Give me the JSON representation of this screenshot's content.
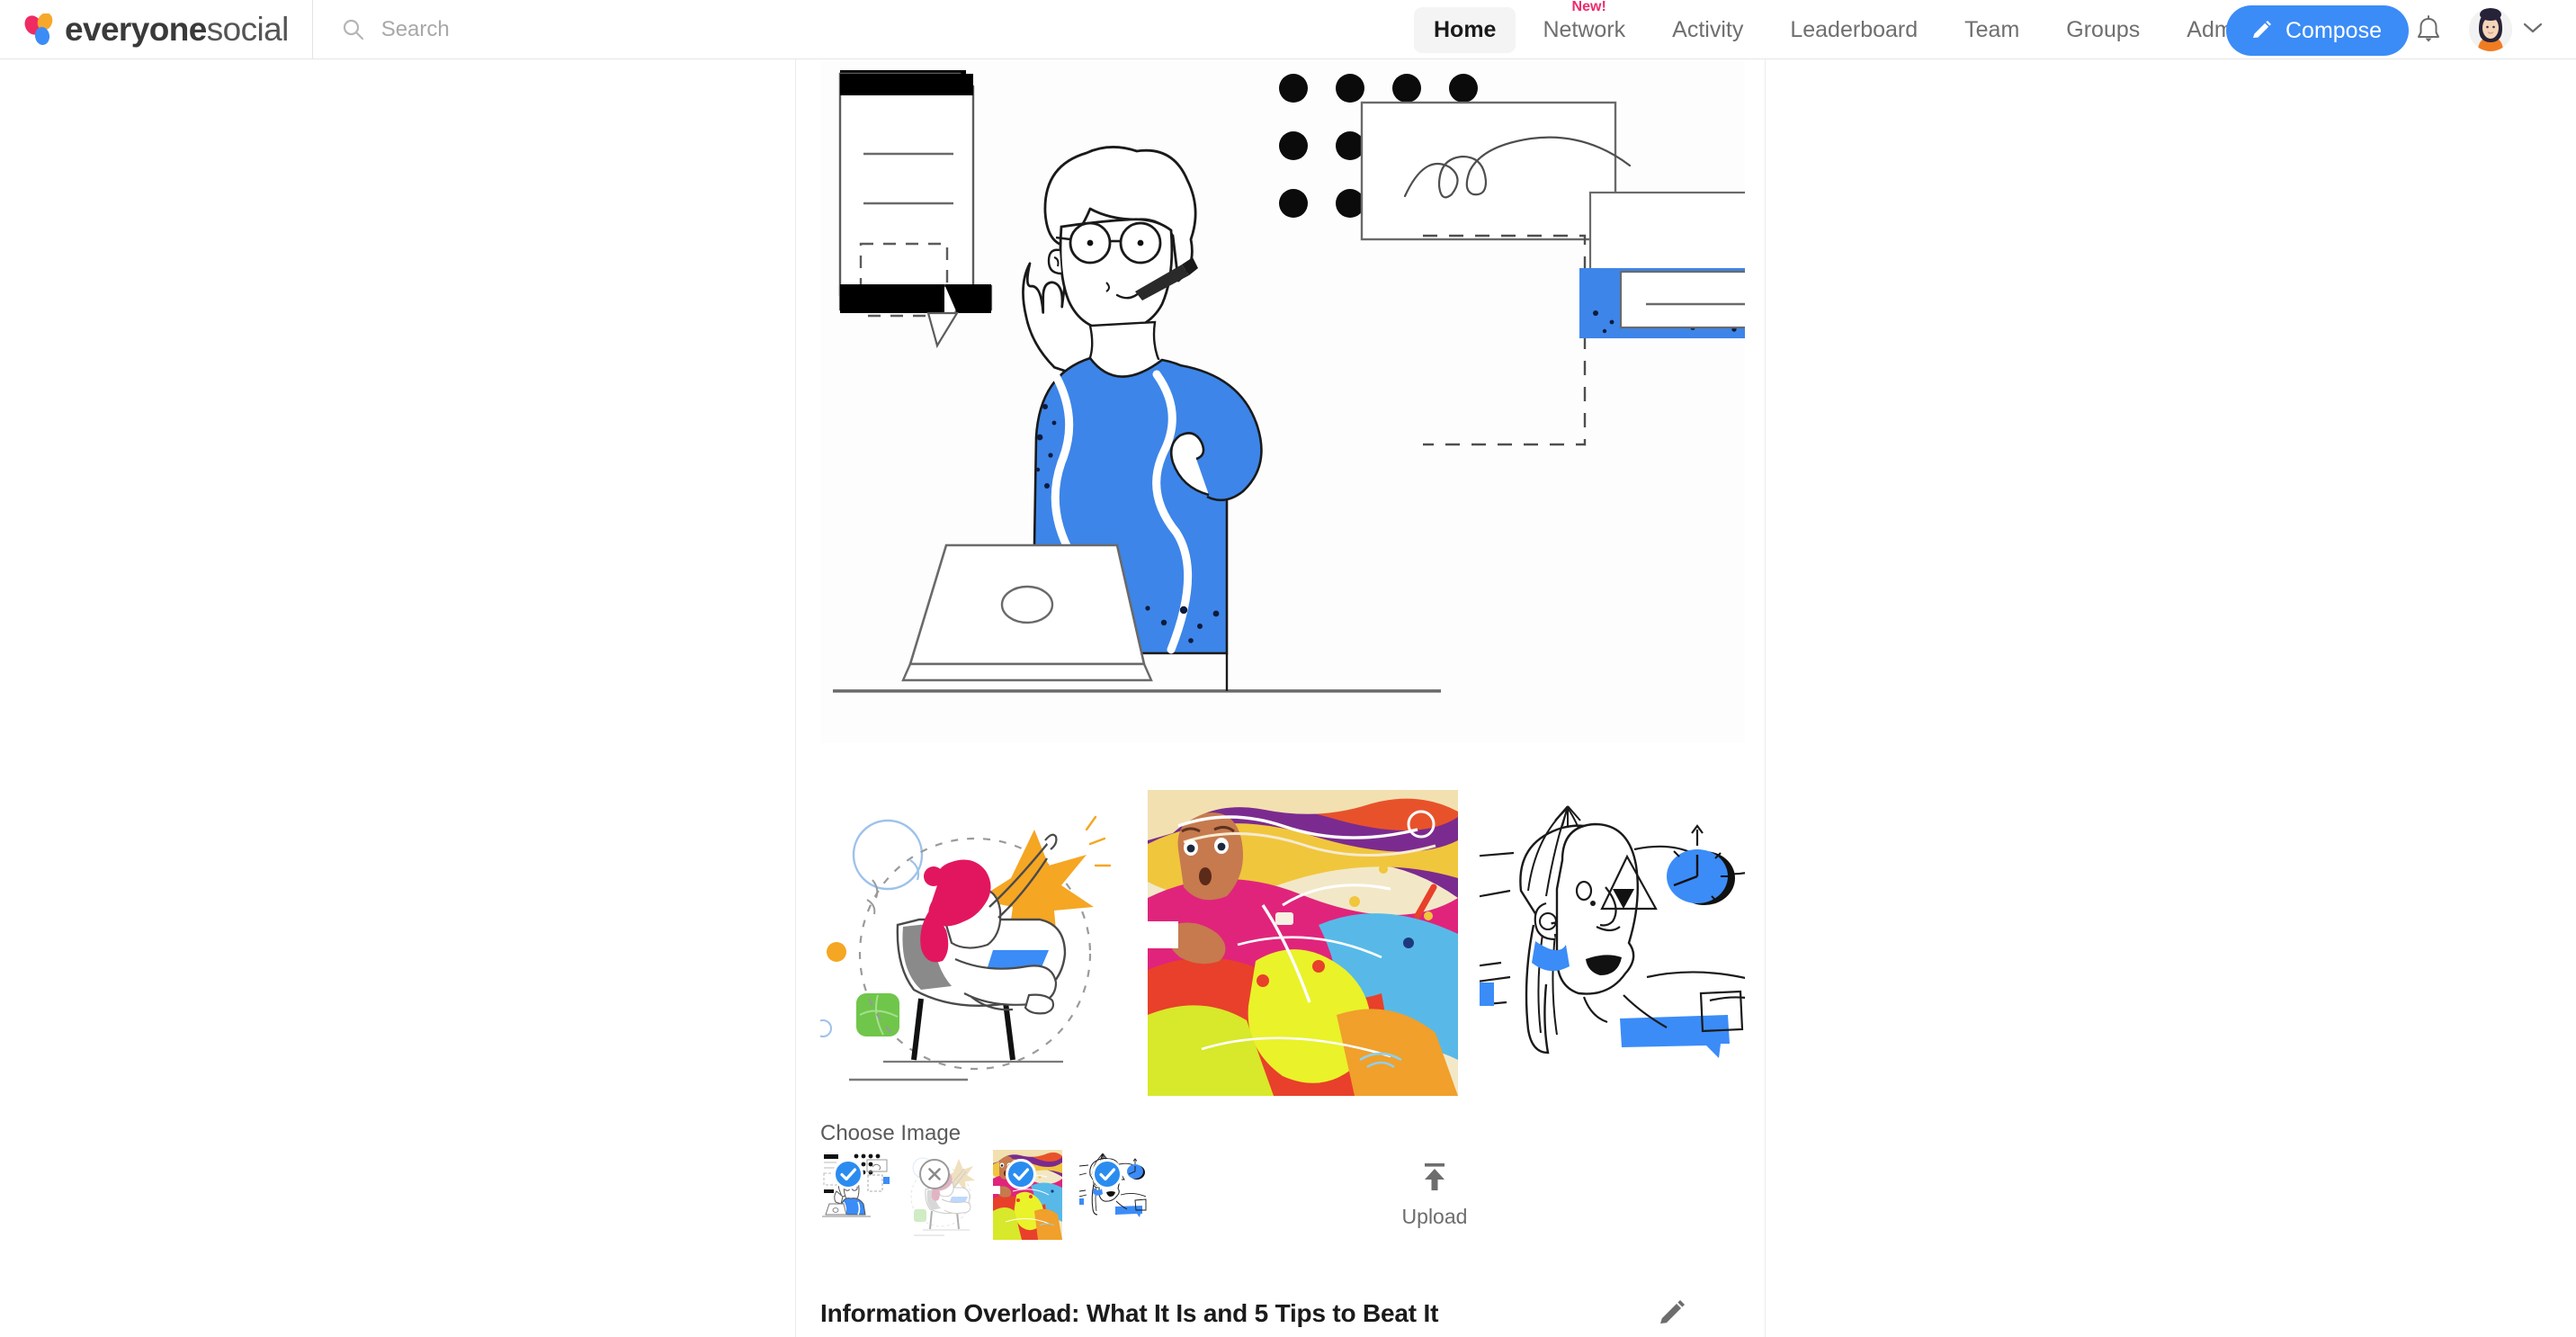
{
  "header": {
    "brand": {
      "name_bold": "everyone",
      "name_light": "social",
      "icon": "everyonesocial-logo-icon"
    },
    "search": {
      "placeholder": "Search",
      "value": "",
      "icon": "search-icon"
    },
    "nav": [
      {
        "label": "Home",
        "active": true,
        "badge": ""
      },
      {
        "label": "Network",
        "active": false,
        "badge": "New!"
      },
      {
        "label": "Activity",
        "active": false,
        "badge": ""
      },
      {
        "label": "Leaderboard",
        "active": false,
        "badge": ""
      },
      {
        "label": "Team",
        "active": false,
        "badge": ""
      },
      {
        "label": "Groups",
        "active": false,
        "badge": ""
      },
      {
        "label": "Admin",
        "active": false,
        "badge": ""
      }
    ],
    "compose": {
      "label": "Compose",
      "icon": "pencil-icon",
      "color": "#3b8cf7"
    },
    "notifications": {
      "icon": "bell-icon"
    },
    "account": {
      "icon": "avatar-icon",
      "chevron": "chevron-down-icon"
    }
  },
  "composer": {
    "hero_image": {
      "alt": "line-art woman with glasses at laptop",
      "accent": "#3d85e8"
    },
    "gallery": [
      {
        "alt": "woman reading in chair with star",
        "selected": false
      },
      {
        "alt": "colorful psychedelic portrait",
        "selected": true
      },
      {
        "alt": "line-art face with blue clock",
        "selected": true
      }
    ],
    "choose_image_label": "Choose Image",
    "thumbnails": [
      {
        "alt": "woman with glasses at laptop",
        "state": "selected",
        "badge_icon": "check-icon"
      },
      {
        "alt": "woman reading in chair with star",
        "state": "hover-remove",
        "badge_icon": "close-icon"
      },
      {
        "alt": "colorful psychedelic portrait",
        "state": "selected",
        "badge_icon": "check-icon"
      },
      {
        "alt": "line-art face with blue clock",
        "state": "selected",
        "badge_icon": "check-icon"
      }
    ],
    "upload": {
      "label": "Upload",
      "icon": "upload-arrow-icon"
    },
    "post_title": "Information Overload: What It Is and 5 Tips to Beat It",
    "edit": {
      "icon": "pencil-edit-icon"
    },
    "cursor": {
      "icon": "grab-hand-cursor-icon"
    }
  },
  "colors": {
    "accent_blue": "#3b8cf7",
    "badge_pink": "#ee2b6c",
    "illustration_blue": "#3d85e8"
  }
}
